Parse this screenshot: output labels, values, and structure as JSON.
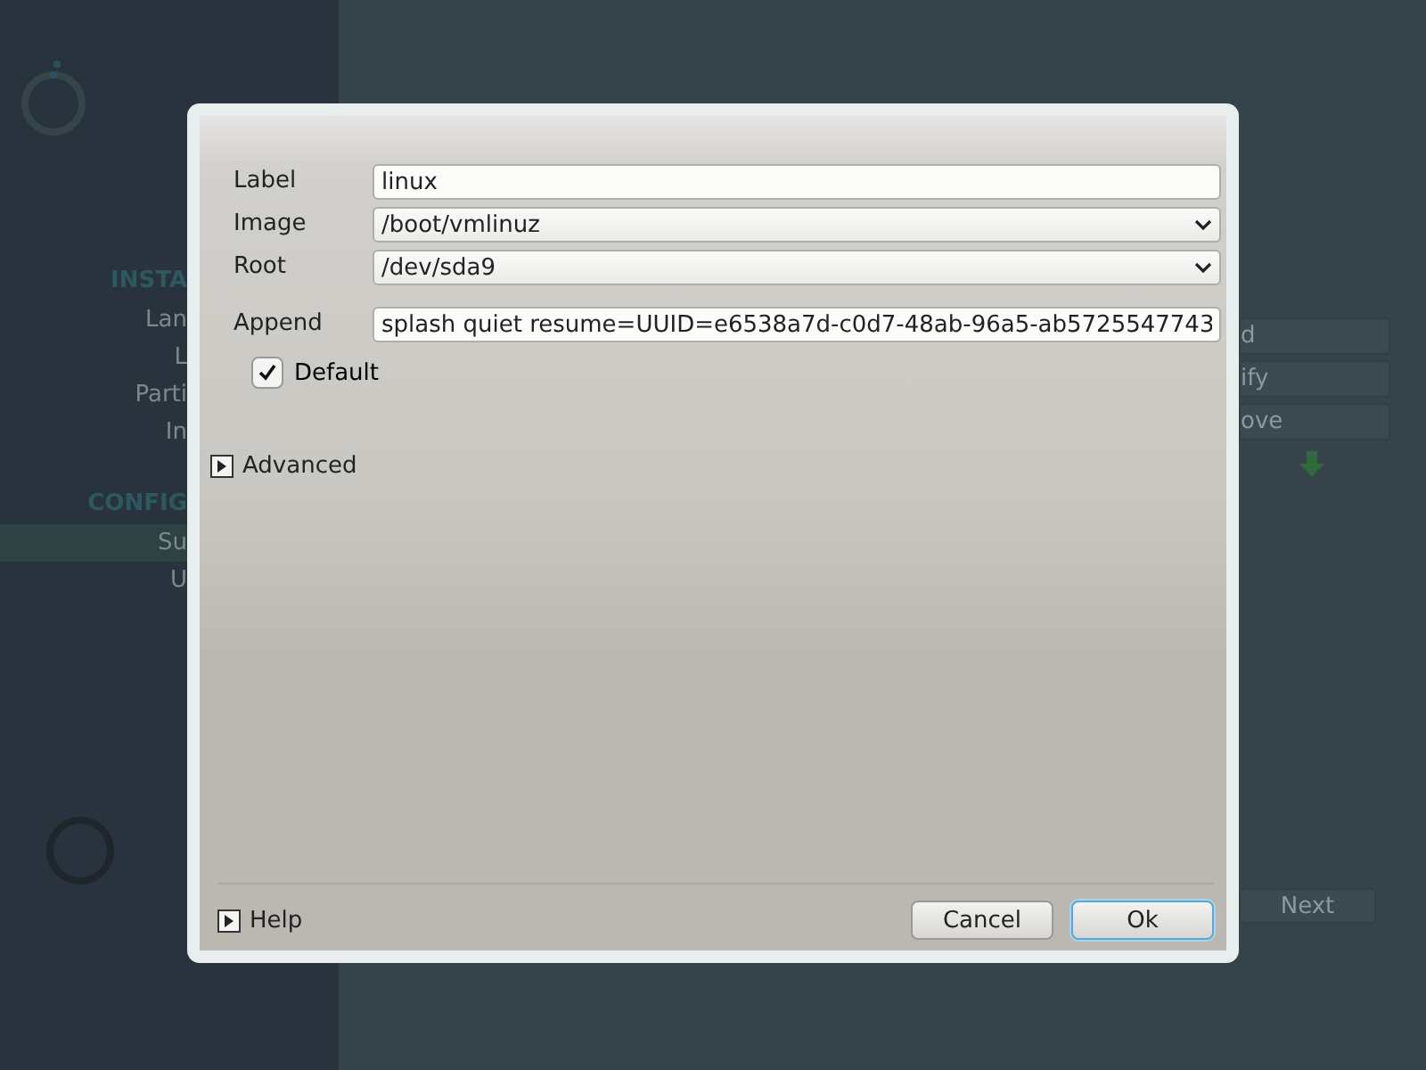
{
  "background": {
    "sidebar": {
      "sections": [
        {
          "heading": "INSTA",
          "items": [
            {
              "label": "Lan",
              "selected": false
            },
            {
              "label": "L",
              "selected": false
            },
            {
              "label": "Parti",
              "selected": false
            },
            {
              "label": "In",
              "selected": false
            }
          ]
        },
        {
          "heading": "CONFIG",
          "items": [
            {
              "label": "Su",
              "selected": true
            },
            {
              "label": "U",
              "selected": false
            }
          ]
        }
      ]
    },
    "buttons": [
      "d",
      "ify",
      "ove"
    ],
    "next_button": "Next"
  },
  "dialog": {
    "fields": [
      {
        "kind": "text",
        "label": "Label",
        "value": "linux"
      },
      {
        "kind": "combo",
        "label": "Image",
        "value": "/boot/vmlinuz"
      },
      {
        "kind": "combo",
        "label": "Root",
        "value": "/dev/sda9"
      },
      {
        "kind": "text",
        "label": "Append",
        "value": "splash quiet resume=UUID=e6538a7d-c0d7-48ab-96a5-ab5725547743"
      }
    ],
    "default_checkbox": {
      "label": "Default",
      "checked": true
    },
    "advanced": {
      "label": "Advanced",
      "expanded": false
    },
    "help": {
      "label": "Help",
      "expanded": false
    },
    "buttons": [
      {
        "label": "Cancel",
        "default": false
      },
      {
        "label": "Ok",
        "default": true
      }
    ]
  }
}
